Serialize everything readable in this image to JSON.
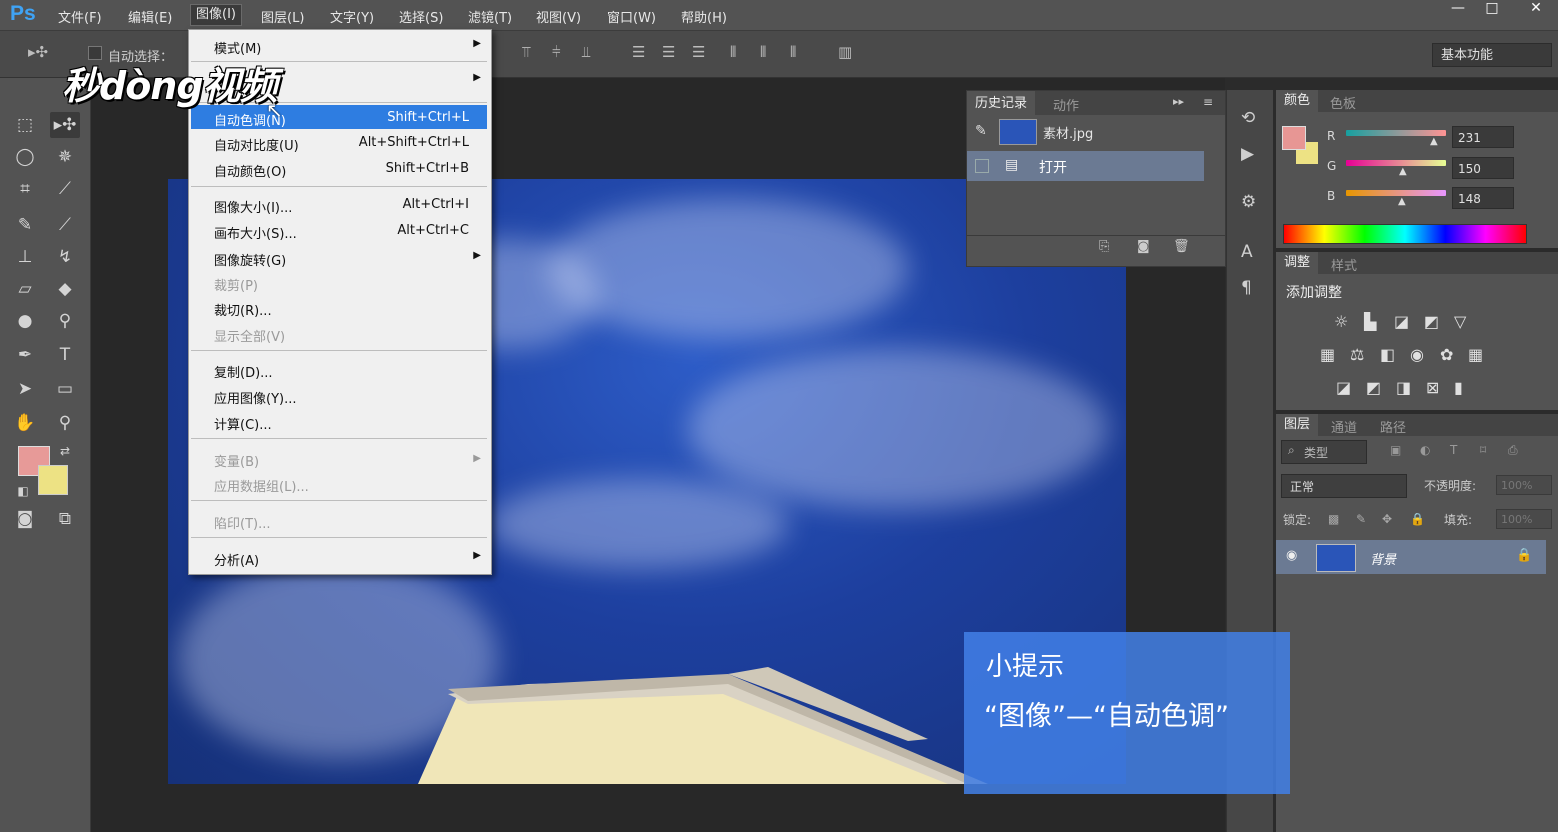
{
  "app": {
    "logo": "Ps"
  },
  "menubar": {
    "items": [
      "文件(F)",
      "编辑(E)",
      "图像(I)",
      "图层(L)",
      "文字(Y)",
      "选择(S)",
      "滤镜(T)",
      "视图(V)",
      "窗口(W)",
      "帮助(H)"
    ],
    "active": "图像(I)",
    "window_buttons": [
      "—",
      "□",
      "✕"
    ]
  },
  "options_bar": {
    "auto_select_label": "自动选择：",
    "workspace": "基本功能"
  },
  "image_menu": {
    "items": [
      {
        "label": "模式(M)",
        "shortcut": "",
        "submenu": true,
        "enabled": true
      },
      {
        "label": "",
        "shortcut": "",
        "submenu": true,
        "enabled": true
      },
      {
        "label": "自动色调(N)",
        "shortcut": "Shift+Ctrl+L",
        "submenu": false,
        "enabled": true,
        "highlighted": true
      },
      {
        "label": "自动对比度(U)",
        "shortcut": "Alt+Shift+Ctrl+L",
        "submenu": false,
        "enabled": true
      },
      {
        "label": "自动颜色(O)",
        "shortcut": "Shift+Ctrl+B",
        "submenu": false,
        "enabled": true
      },
      {
        "label": "图像大小(I)...",
        "shortcut": "Alt+Ctrl+I",
        "submenu": false,
        "enabled": true
      },
      {
        "label": "画布大小(S)...",
        "shortcut": "Alt+Ctrl+C",
        "submenu": false,
        "enabled": true
      },
      {
        "label": "图像旋转(G)",
        "shortcut": "",
        "submenu": true,
        "enabled": true
      },
      {
        "label": "裁剪(P)",
        "shortcut": "",
        "submenu": false,
        "enabled": false
      },
      {
        "label": "裁切(R)...",
        "shortcut": "",
        "submenu": false,
        "enabled": true
      },
      {
        "label": "显示全部(V)",
        "shortcut": "",
        "submenu": false,
        "enabled": false
      },
      {
        "label": "复制(D)...",
        "shortcut": "",
        "submenu": false,
        "enabled": true
      },
      {
        "label": "应用图像(Y)...",
        "shortcut": "",
        "submenu": false,
        "enabled": true
      },
      {
        "label": "计算(C)...",
        "shortcut": "",
        "submenu": false,
        "enabled": true
      },
      {
        "label": "变量(B)",
        "shortcut": "",
        "submenu": true,
        "enabled": false
      },
      {
        "label": "应用数据组(L)...",
        "shortcut": "",
        "submenu": false,
        "enabled": false
      },
      {
        "label": "陷印(T)...",
        "shortcut": "",
        "submenu": false,
        "enabled": false
      },
      {
        "label": "分析(A)",
        "shortcut": "",
        "submenu": true,
        "enabled": true
      }
    ]
  },
  "history_panel": {
    "tabs": [
      "历史记录",
      "动作"
    ],
    "snapshot": "素材.jpg",
    "steps": [
      "打开"
    ]
  },
  "color_panel": {
    "tabs": [
      "颜色",
      "色板"
    ],
    "channels": [
      {
        "name": "R",
        "value": "231"
      },
      {
        "name": "G",
        "value": "150"
      },
      {
        "name": "B",
        "value": "148"
      }
    ],
    "fg_color": "#e79694",
    "bg_color": "#ede284"
  },
  "adjustments_panel": {
    "tabs": [
      "调整",
      "样式"
    ],
    "title": "添加调整"
  },
  "layers_panel": {
    "tabs": [
      "图层",
      "通道",
      "路径"
    ],
    "filter": "类型",
    "blend_mode": "正常",
    "opacity_label": "不透明度:",
    "opacity_value": "100%",
    "lock_label": "锁定:",
    "fill_label": "填充:",
    "fill_value": "100%",
    "layers": [
      {
        "name": "背景",
        "locked": true,
        "visible": true
      }
    ]
  },
  "overlay": {
    "watermark": "秒dòng视频",
    "tip_title": "小提示",
    "tip_text": "“图像”—“自动色调”"
  }
}
